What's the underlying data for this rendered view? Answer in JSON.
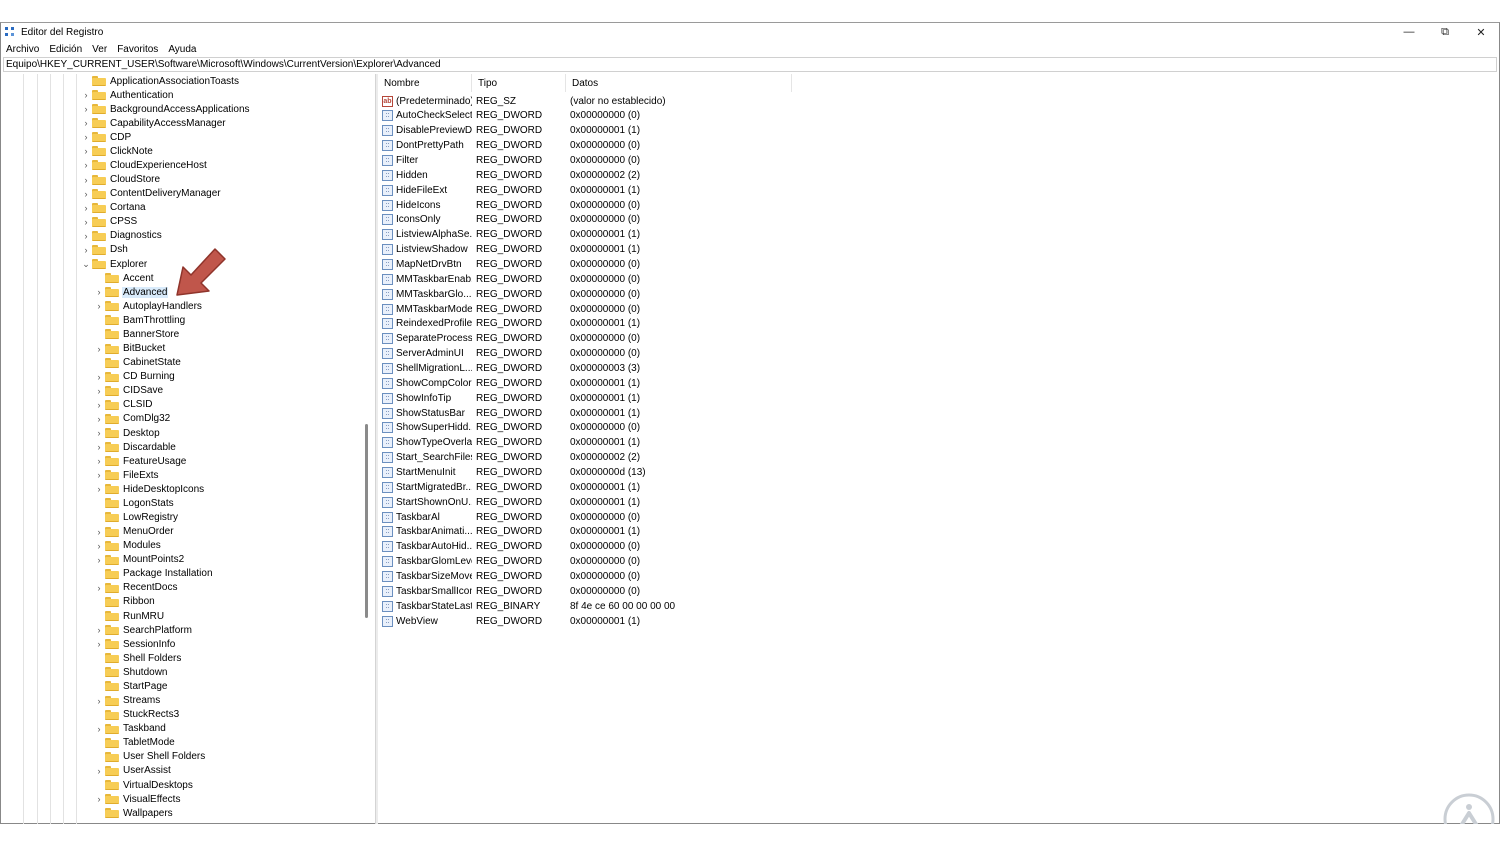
{
  "window": {
    "title": "Editor del Registro",
    "controls": {
      "minimize": "—",
      "restore": "⧉",
      "close": "✕"
    }
  },
  "menu": [
    "Archivo",
    "Edición",
    "Ver",
    "Favoritos",
    "Ayuda"
  ],
  "address": "Equipo\\HKEY_CURRENT_USER\\Software\\Microsoft\\Windows\\CurrentVersion\\Explorer\\Advanced",
  "tree": {
    "selected": "Advanced",
    "parent_items": [
      {
        "label": "ApplicationAssociationToasts",
        "expandable": false
      },
      {
        "label": "Authentication",
        "expandable": true
      },
      {
        "label": "BackgroundAccessApplications",
        "expandable": true
      },
      {
        "label": "CapabilityAccessManager",
        "expandable": true
      },
      {
        "label": "CDP",
        "expandable": true
      },
      {
        "label": "ClickNote",
        "expandable": true
      },
      {
        "label": "CloudExperienceHost",
        "expandable": true
      },
      {
        "label": "CloudStore",
        "expandable": true
      },
      {
        "label": "ContentDeliveryManager",
        "expandable": true
      },
      {
        "label": "Cortana",
        "expandable": true
      },
      {
        "label": "CPSS",
        "expandable": true
      },
      {
        "label": "Diagnostics",
        "expandable": true
      },
      {
        "label": "Dsh",
        "expandable": true
      },
      {
        "label": "Explorer",
        "expandable": true,
        "expanded": true
      }
    ],
    "explorer_children": [
      {
        "label": "Accent",
        "expandable": false
      },
      {
        "label": "Advanced",
        "expandable": true
      },
      {
        "label": "AutoplayHandlers",
        "expandable": true
      },
      {
        "label": "BamThrottling",
        "expandable": false
      },
      {
        "label": "BannerStore",
        "expandable": false
      },
      {
        "label": "BitBucket",
        "expandable": true
      },
      {
        "label": "CabinetState",
        "expandable": false
      },
      {
        "label": "CD Burning",
        "expandable": true
      },
      {
        "label": "CIDSave",
        "expandable": true
      },
      {
        "label": "CLSID",
        "expandable": true
      },
      {
        "label": "ComDlg32",
        "expandable": true
      },
      {
        "label": "Desktop",
        "expandable": true
      },
      {
        "label": "Discardable",
        "expandable": true
      },
      {
        "label": "FeatureUsage",
        "expandable": true
      },
      {
        "label": "FileExts",
        "expandable": true
      },
      {
        "label": "HideDesktopIcons",
        "expandable": true
      },
      {
        "label": "LogonStats",
        "expandable": false
      },
      {
        "label": "LowRegistry",
        "expandable": false
      },
      {
        "label": "MenuOrder",
        "expandable": true
      },
      {
        "label": "Modules",
        "expandable": true
      },
      {
        "label": "MountPoints2",
        "expandable": true
      },
      {
        "label": "Package Installation",
        "expandable": false
      },
      {
        "label": "RecentDocs",
        "expandable": true
      },
      {
        "label": "Ribbon",
        "expandable": false
      },
      {
        "label": "RunMRU",
        "expandable": false
      },
      {
        "label": "SearchPlatform",
        "expandable": true
      },
      {
        "label": "SessionInfo",
        "expandable": true
      },
      {
        "label": "Shell Folders",
        "expandable": false
      },
      {
        "label": "Shutdown",
        "expandable": false
      },
      {
        "label": "StartPage",
        "expandable": false
      },
      {
        "label": "Streams",
        "expandable": true
      },
      {
        "label": "StuckRects3",
        "expandable": false
      },
      {
        "label": "Taskband",
        "expandable": true
      },
      {
        "label": "TabletMode",
        "expandable": false
      },
      {
        "label": "User Shell Folders",
        "expandable": false
      },
      {
        "label": "UserAssist",
        "expandable": true
      },
      {
        "label": "VirtualDesktops",
        "expandable": false
      },
      {
        "label": "VisualEffects",
        "expandable": true
      },
      {
        "label": "Wallpapers",
        "expandable": false
      }
    ]
  },
  "list": {
    "columns": [
      "Nombre",
      "Tipo",
      "Datos"
    ],
    "rows": [
      {
        "name": "(Predeterminado)",
        "type": "REG_SZ",
        "data": "(valor no establecido)",
        "icon": "ab"
      },
      {
        "name": "AutoCheckSelect",
        "type": "REG_DWORD",
        "data": "0x00000000 (0)",
        "icon": "dword"
      },
      {
        "name": "DisablePreviewD...",
        "type": "REG_DWORD",
        "data": "0x00000001 (1)",
        "icon": "dword"
      },
      {
        "name": "DontPrettyPath",
        "type": "REG_DWORD",
        "data": "0x00000000 (0)",
        "icon": "dword"
      },
      {
        "name": "Filter",
        "type": "REG_DWORD",
        "data": "0x00000000 (0)",
        "icon": "dword"
      },
      {
        "name": "Hidden",
        "type": "REG_DWORD",
        "data": "0x00000002 (2)",
        "icon": "dword"
      },
      {
        "name": "HideFileExt",
        "type": "REG_DWORD",
        "data": "0x00000001 (1)",
        "icon": "dword"
      },
      {
        "name": "HideIcons",
        "type": "REG_DWORD",
        "data": "0x00000000 (0)",
        "icon": "dword"
      },
      {
        "name": "IconsOnly",
        "type": "REG_DWORD",
        "data": "0x00000000 (0)",
        "icon": "dword"
      },
      {
        "name": "ListviewAlphaSe...",
        "type": "REG_DWORD",
        "data": "0x00000001 (1)",
        "icon": "dword"
      },
      {
        "name": "ListviewShadow",
        "type": "REG_DWORD",
        "data": "0x00000001 (1)",
        "icon": "dword"
      },
      {
        "name": "MapNetDrvBtn",
        "type": "REG_DWORD",
        "data": "0x00000000 (0)",
        "icon": "dword"
      },
      {
        "name": "MMTaskbarEnab...",
        "type": "REG_DWORD",
        "data": "0x00000000 (0)",
        "icon": "dword"
      },
      {
        "name": "MMTaskbarGlo...",
        "type": "REG_DWORD",
        "data": "0x00000000 (0)",
        "icon": "dword"
      },
      {
        "name": "MMTaskbarMode",
        "type": "REG_DWORD",
        "data": "0x00000000 (0)",
        "icon": "dword"
      },
      {
        "name": "ReindexedProfile",
        "type": "REG_DWORD",
        "data": "0x00000001 (1)",
        "icon": "dword"
      },
      {
        "name": "SeparateProcess",
        "type": "REG_DWORD",
        "data": "0x00000000 (0)",
        "icon": "dword"
      },
      {
        "name": "ServerAdminUI",
        "type": "REG_DWORD",
        "data": "0x00000000 (0)",
        "icon": "dword"
      },
      {
        "name": "ShellMigrationL...",
        "type": "REG_DWORD",
        "data": "0x00000003 (3)",
        "icon": "dword"
      },
      {
        "name": "ShowCompColor",
        "type": "REG_DWORD",
        "data": "0x00000001 (1)",
        "icon": "dword"
      },
      {
        "name": "ShowInfoTip",
        "type": "REG_DWORD",
        "data": "0x00000001 (1)",
        "icon": "dword"
      },
      {
        "name": "ShowStatusBar",
        "type": "REG_DWORD",
        "data": "0x00000001 (1)",
        "icon": "dword"
      },
      {
        "name": "ShowSuperHidd...",
        "type": "REG_DWORD",
        "data": "0x00000000 (0)",
        "icon": "dword"
      },
      {
        "name": "ShowTypeOverlay",
        "type": "REG_DWORD",
        "data": "0x00000001 (1)",
        "icon": "dword"
      },
      {
        "name": "Start_SearchFiles",
        "type": "REG_DWORD",
        "data": "0x00000002 (2)",
        "icon": "dword"
      },
      {
        "name": "StartMenuInit",
        "type": "REG_DWORD",
        "data": "0x0000000d (13)",
        "icon": "dword"
      },
      {
        "name": "StartMigratedBr...",
        "type": "REG_DWORD",
        "data": "0x00000001 (1)",
        "icon": "dword"
      },
      {
        "name": "StartShownOnU...",
        "type": "REG_DWORD",
        "data": "0x00000001 (1)",
        "icon": "dword"
      },
      {
        "name": "TaskbarAl",
        "type": "REG_DWORD",
        "data": "0x00000000 (0)",
        "icon": "dword"
      },
      {
        "name": "TaskbarAnimati...",
        "type": "REG_DWORD",
        "data": "0x00000001 (1)",
        "icon": "dword"
      },
      {
        "name": "TaskbarAutoHid...",
        "type": "REG_DWORD",
        "data": "0x00000000 (0)",
        "icon": "dword"
      },
      {
        "name": "TaskbarGlomLevel",
        "type": "REG_DWORD",
        "data": "0x00000000 (0)",
        "icon": "dword"
      },
      {
        "name": "TaskbarSizeMove",
        "type": "REG_DWORD",
        "data": "0x00000000 (0)",
        "icon": "dword"
      },
      {
        "name": "TaskbarSmallIcons",
        "type": "REG_DWORD",
        "data": "0x00000000 (0)",
        "icon": "dword"
      },
      {
        "name": "TaskbarStateLast...",
        "type": "REG_BINARY",
        "data": "8f 4e ce 60 00 00 00 00",
        "icon": "dword"
      },
      {
        "name": "WebView",
        "type": "REG_DWORD",
        "data": "0x00000001 (1)",
        "icon": "dword"
      }
    ]
  },
  "colors": {
    "selection": "#d9ebfb",
    "folder": "#f7cd55",
    "annotation_arrow": "#c0564b",
    "watermark": "#c9ced4"
  }
}
